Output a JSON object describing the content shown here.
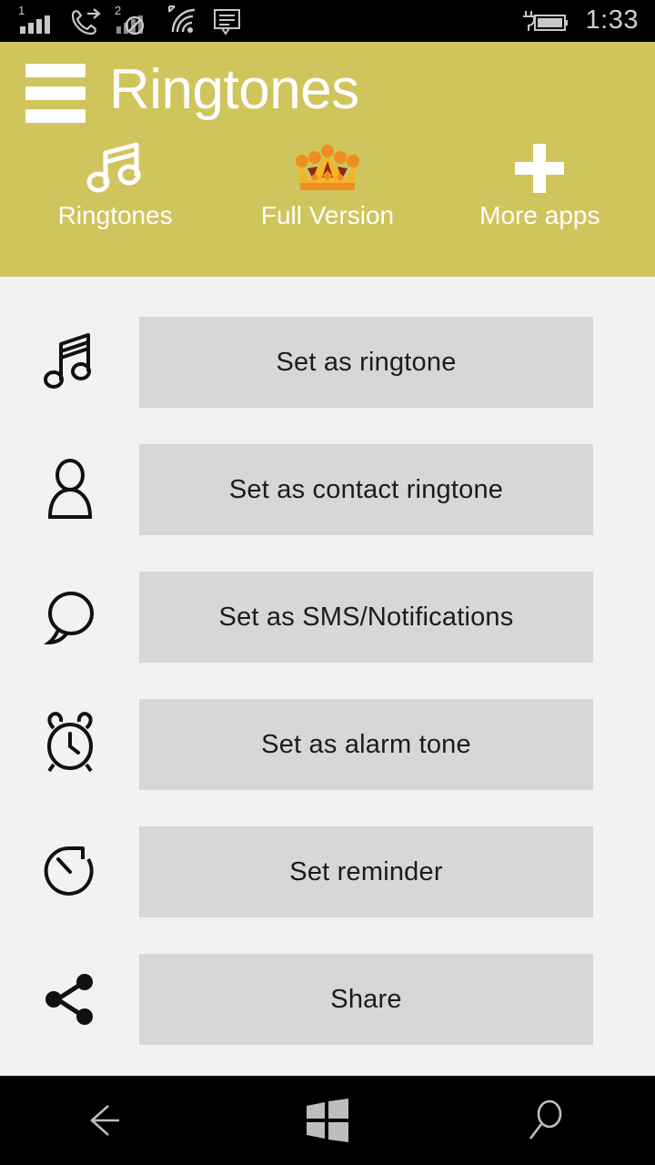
{
  "statusbar": {
    "icons": [
      {
        "name": "signal-bars-sim1-icon",
        "badge": "1"
      },
      {
        "name": "call-forwarding-icon",
        "badge": ""
      },
      {
        "name": "signal-blocked-sim2-icon",
        "badge": "2"
      },
      {
        "name": "wifi-icon",
        "badge": ""
      },
      {
        "name": "message-icon",
        "badge": ""
      }
    ],
    "battery_icon": "battery-charging-icon",
    "time": "1:33"
  },
  "header": {
    "menu_icon": "hamburger-menu-icon",
    "title": "Ringtones",
    "background_color": "#d0c45c",
    "tabs": [
      {
        "label": "Ringtones",
        "icon": "music-note-icon"
      },
      {
        "label": "Full Version",
        "icon": "crown-icon"
      },
      {
        "label": "More apps",
        "icon": "plus-icon"
      }
    ]
  },
  "main": {
    "background_color": "#f1f2f4",
    "button_color": "#d6d7d8",
    "rows": [
      {
        "label": "Set as ringtone",
        "icon": "music-note-icon"
      },
      {
        "label": "Set as contact ringtone",
        "icon": "contact-person-icon"
      },
      {
        "label": "Set as SMS/Notifications",
        "icon": "speech-bubble-icon"
      },
      {
        "label": "Set as alarm tone",
        "icon": "alarm-clock-icon"
      },
      {
        "label": "Set reminder",
        "icon": "timer-icon"
      },
      {
        "label": "Share",
        "icon": "share-icon"
      }
    ]
  },
  "navbar": {
    "buttons": [
      {
        "name": "back-button",
        "icon": "back-arrow-icon"
      },
      {
        "name": "start-button",
        "icon": "windows-logo-icon"
      },
      {
        "name": "search-button",
        "icon": "search-icon"
      }
    ]
  },
  "colors": {
    "accent": "#d0c45c",
    "crown_gold": "#f5b425",
    "crown_orange": "#ef8c22",
    "crown_dark": "#8f2b16",
    "status_icon": "#c8c8c8",
    "nav_icon": "#bdbdbd"
  }
}
